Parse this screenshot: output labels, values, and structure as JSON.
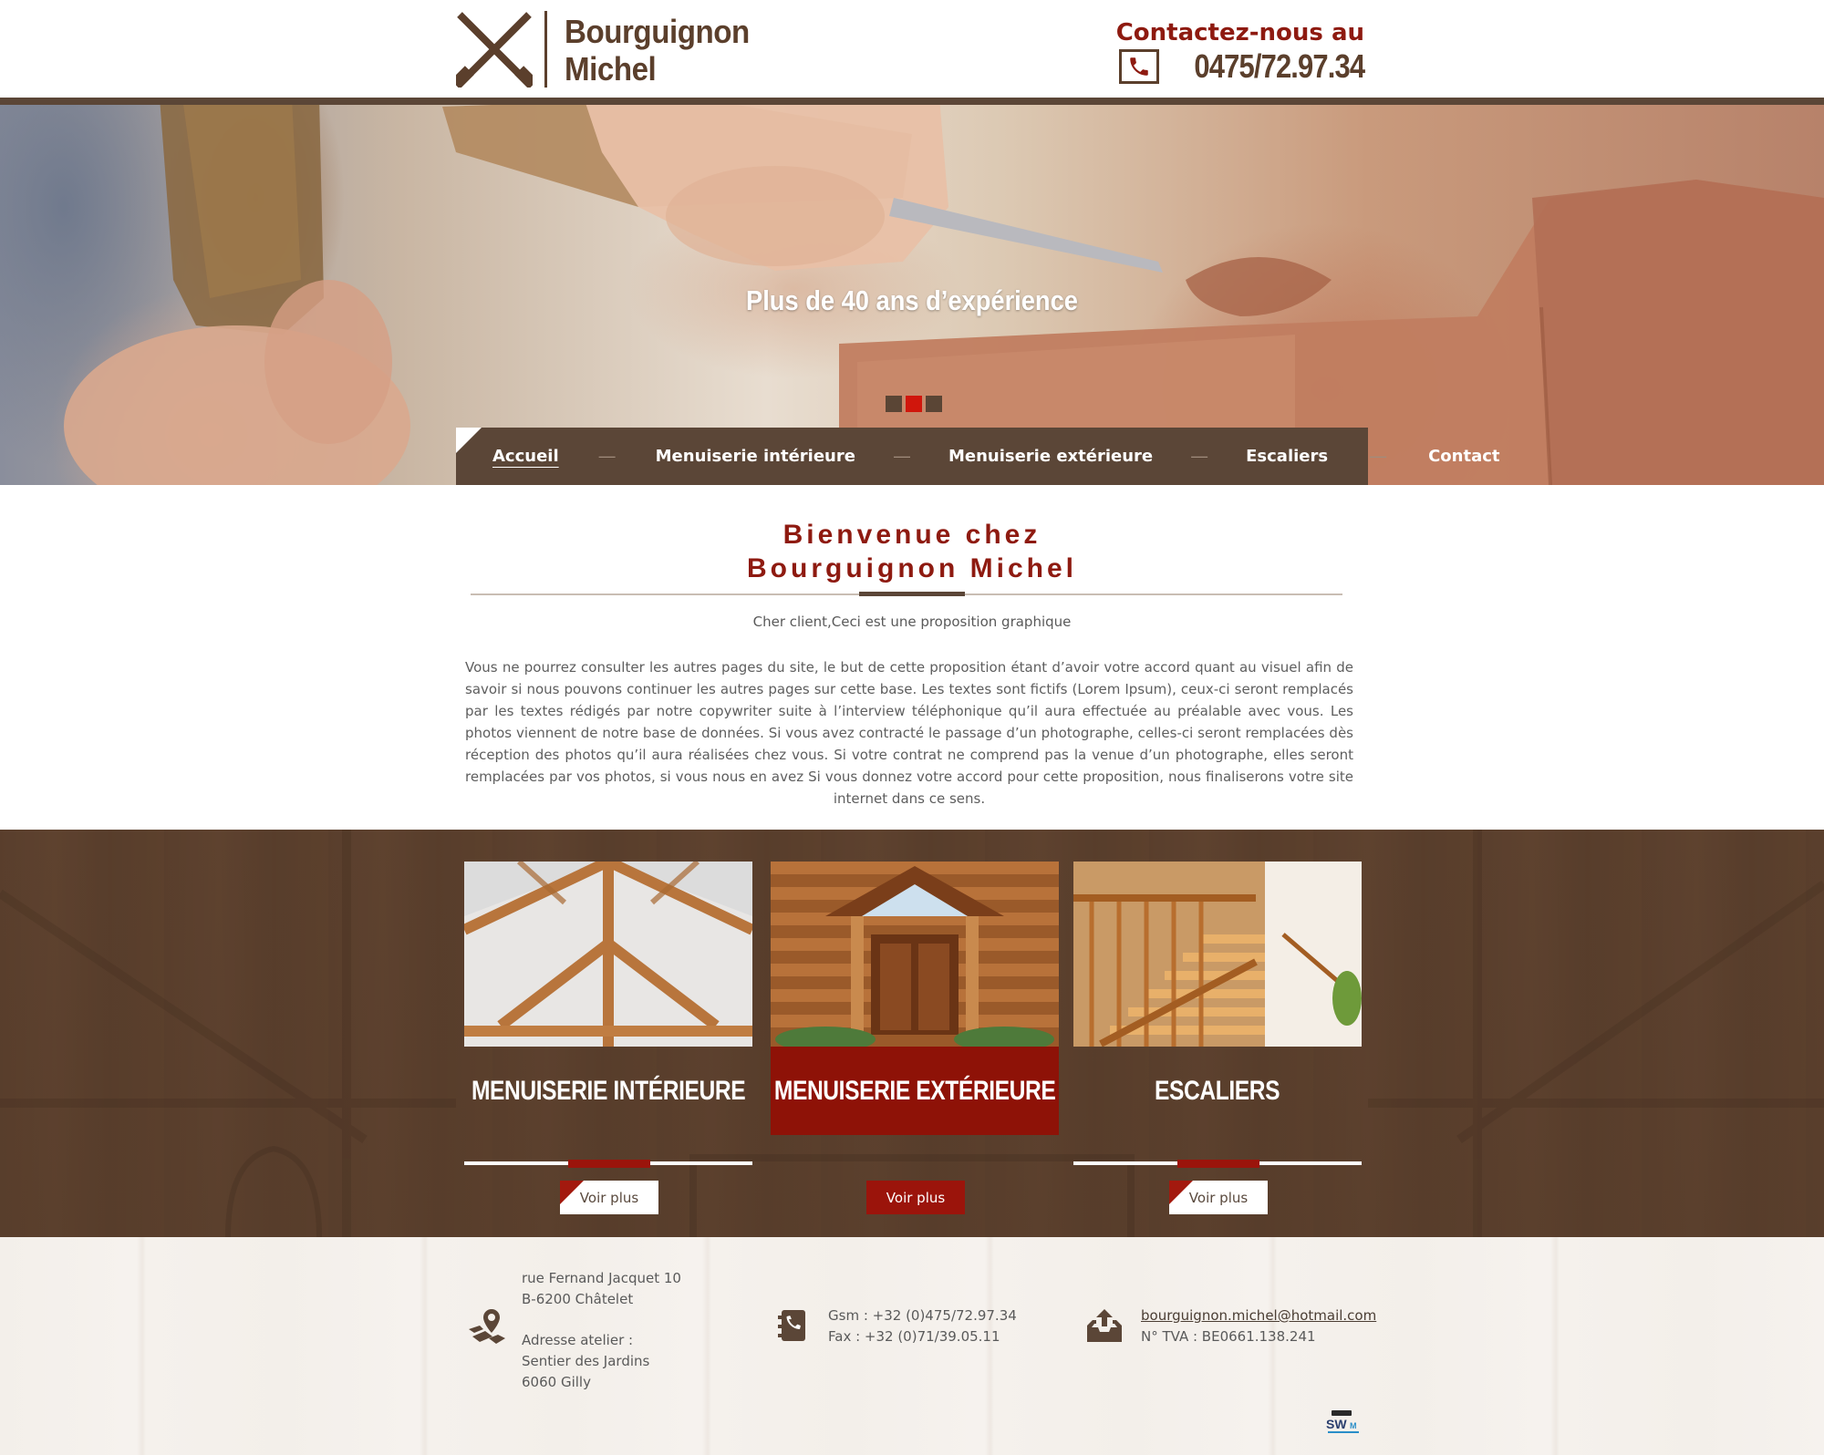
{
  "brand": {
    "name_line1": "Bourguignon",
    "name_line2": "Michel",
    "logo_icon": "crossed-chisels-icon"
  },
  "header_contact": {
    "label": "Contactez-nous au",
    "phone": "0475/72.97.34",
    "phone_icon": "phone-icon"
  },
  "hero": {
    "title": "Plus de 40 ans d’expérience",
    "slides_count": 3,
    "active_slide": 2
  },
  "nav": {
    "items": [
      {
        "label": "Accueil",
        "active": true
      },
      {
        "label": "Menuiserie intérieure",
        "active": false
      },
      {
        "label": "Menuiserie extérieure",
        "active": false
      },
      {
        "label": "Escaliers",
        "active": false
      },
      {
        "label": "Contact",
        "active": false
      }
    ],
    "separator": "—"
  },
  "welcome": {
    "title_line1": "Bienvenue chez",
    "title_line2": "Bourguignon Michel",
    "intro": "Cher client,Ceci est  une proposition graphique",
    "body": "Vous ne pourrez consulter les autres pages du site, le but de cette proposition étant d’avoir votre accord quant au visuel afin de savoir si nous pouvons continuer les autres pages sur cette base. Les textes sont fictifs (Lorem Ipsum), ceux-ci seront remplacés par les textes rédigés par notre copywriter suite à l’interview téléphonique qu’il aura effectuée au préalable avec vous. Les photos viennent de notre base de données. Si vous avez contracté le passage d’un photographe, celles-ci seront remplacées dès réception des photos qu’il aura réalisées chez vous. Si votre contrat ne comprend pas la venue d’un photographe, elles seront remplacées par vos photos, si vous nous en avez Si vous donnez votre accord pour cette proposition, nous finaliserons votre site internet dans ce sens."
  },
  "services": [
    {
      "title": "MENUISERIE INTÉRIEURE",
      "button": "Voir plus",
      "featured": false
    },
    {
      "title": "MENUISERIE EXTÉRIEURE",
      "button": "Voir plus",
      "featured": true
    },
    {
      "title": "ESCALIERS",
      "button": "Voir plus",
      "featured": false
    }
  ],
  "footer": {
    "address": {
      "street": "rue Fernand Jacquet 10",
      "city": "B-6200 Châtelet",
      "atelier_label": "Adresse atelier :",
      "atelier_street": "Sentier des Jardins",
      "atelier_city": "6060 Gilly",
      "icon": "map-location-icon"
    },
    "phones": {
      "gsm": "Gsm : +32 (0)475/72.97.34",
      "fax": "Fax :   +32 (0)71/39.05.11",
      "icon": "phone-book-icon"
    },
    "mail": {
      "email": "bourguignon.michel@hotmail.com",
      "tva": "N° TVA : BE0661.138.241",
      "icon": "mail-upload-icon"
    },
    "credit_logo": "SWM"
  },
  "colors": {
    "brown": "#5b4637",
    "dark_red": "#8e1a10",
    "accent_red": "#d0160c",
    "footer_bg": "#f3efea"
  }
}
